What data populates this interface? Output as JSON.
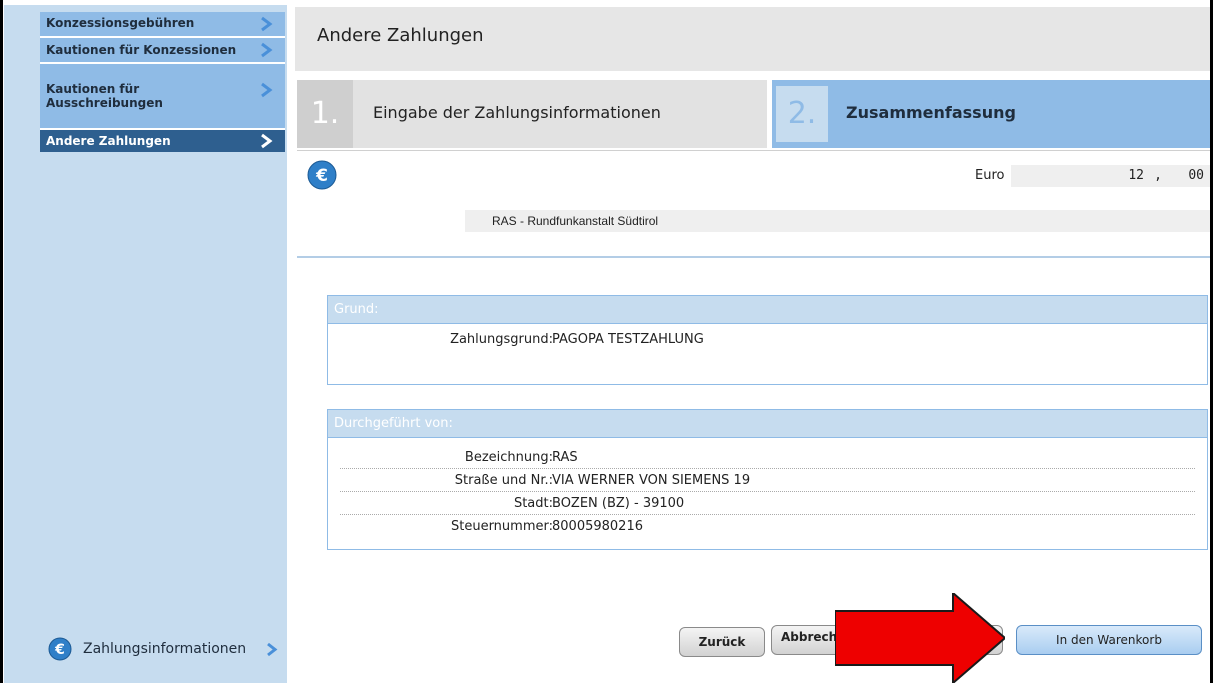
{
  "sidebar": {
    "items": [
      {
        "label": "Konzessionsgebühren"
      },
      {
        "label": "Kautionen für Konzessionen"
      },
      {
        "label_line1": "Kautionen für",
        "label_line2": "Ausschreibungen"
      },
      {
        "label": "Andere Zahlungen"
      }
    ],
    "bottom_link": "Zahlungsinformationen"
  },
  "header": {
    "title": "Andere Zahlungen"
  },
  "steps": [
    {
      "number": "1.",
      "label": "Eingabe der Zahlungsinformationen",
      "state": "inactive"
    },
    {
      "number": "2.",
      "label": "Zusammenfassung",
      "state": "active"
    }
  ],
  "amount": {
    "currency_label": "Euro",
    "integer": "12",
    "separator": ",",
    "decimal": "00"
  },
  "payee": {
    "name": "RAS - Rundfunkanstalt Südtirol"
  },
  "reason": {
    "legend": "Grund:",
    "fields": [
      {
        "key": "Zahlungsgrund:",
        "value": "PAGOPA TESTZAHLUNG"
      }
    ]
  },
  "performer": {
    "legend": "Durchgeführt von:",
    "fields": [
      {
        "key": "Bezeichnung:",
        "value": "RAS"
      },
      {
        "key": "Straße und Nr.:",
        "value": "VIA WERNER VON SIEMENS 19"
      },
      {
        "key": "Stadt:",
        "value": "BOZEN (BZ) - 39100"
      },
      {
        "key": "Steuernummer:",
        "value": "80005980216"
      }
    ]
  },
  "buttons": {
    "back": "Zurück",
    "cancel": "Abbrech",
    "add_to_cart": "In den Warenkorb"
  },
  "colors": {
    "sidebar_bg": "#c6dcef",
    "sidebar_item": "#8fbbe6",
    "sidebar_active": "#2e5f8f",
    "step_active": "#8fbbe6",
    "annotation_arrow": "#ee0000"
  },
  "icons": [
    "chevron-right-icon",
    "euro-icon",
    "red-arrow-annotation"
  ]
}
